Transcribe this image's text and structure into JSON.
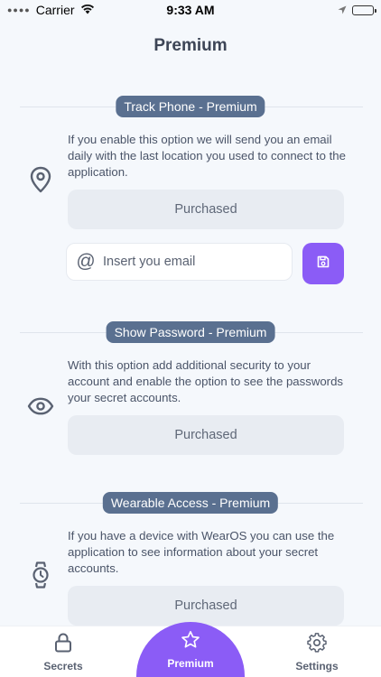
{
  "status": {
    "carrier": "Carrier",
    "time": "9:33 AM"
  },
  "page": {
    "title": "Premium"
  },
  "sections": [
    {
      "pill": "Track Phone - Premium",
      "description": "If you enable this option we will send you an email daily with the last location you used to connect to the application.",
      "button": "Purchased",
      "icon": "location-pin-icon"
    },
    {
      "pill": "Show Password - Premium",
      "description": "With this option add additional security to your account and enable the option to see the passwords your secret accounts.",
      "button": "Purchased",
      "icon": "eye-icon"
    },
    {
      "pill": "Wearable Access - Premium",
      "description": "If you have a device with WearOS you can use the application to see information about your secret accounts.",
      "button": "Purchased",
      "icon": "watch-icon"
    }
  ],
  "email": {
    "placeholder": "Insert you email",
    "value": ""
  },
  "tabs": [
    {
      "label": "Secrets",
      "icon": "lock-icon"
    },
    {
      "label": "Premium",
      "icon": "star-icon"
    },
    {
      "label": "Settings",
      "icon": "gear-icon"
    }
  ],
  "colors": {
    "accent": "#8b5cf6",
    "pill": "#5a7090",
    "background": "#f5f8fc"
  }
}
